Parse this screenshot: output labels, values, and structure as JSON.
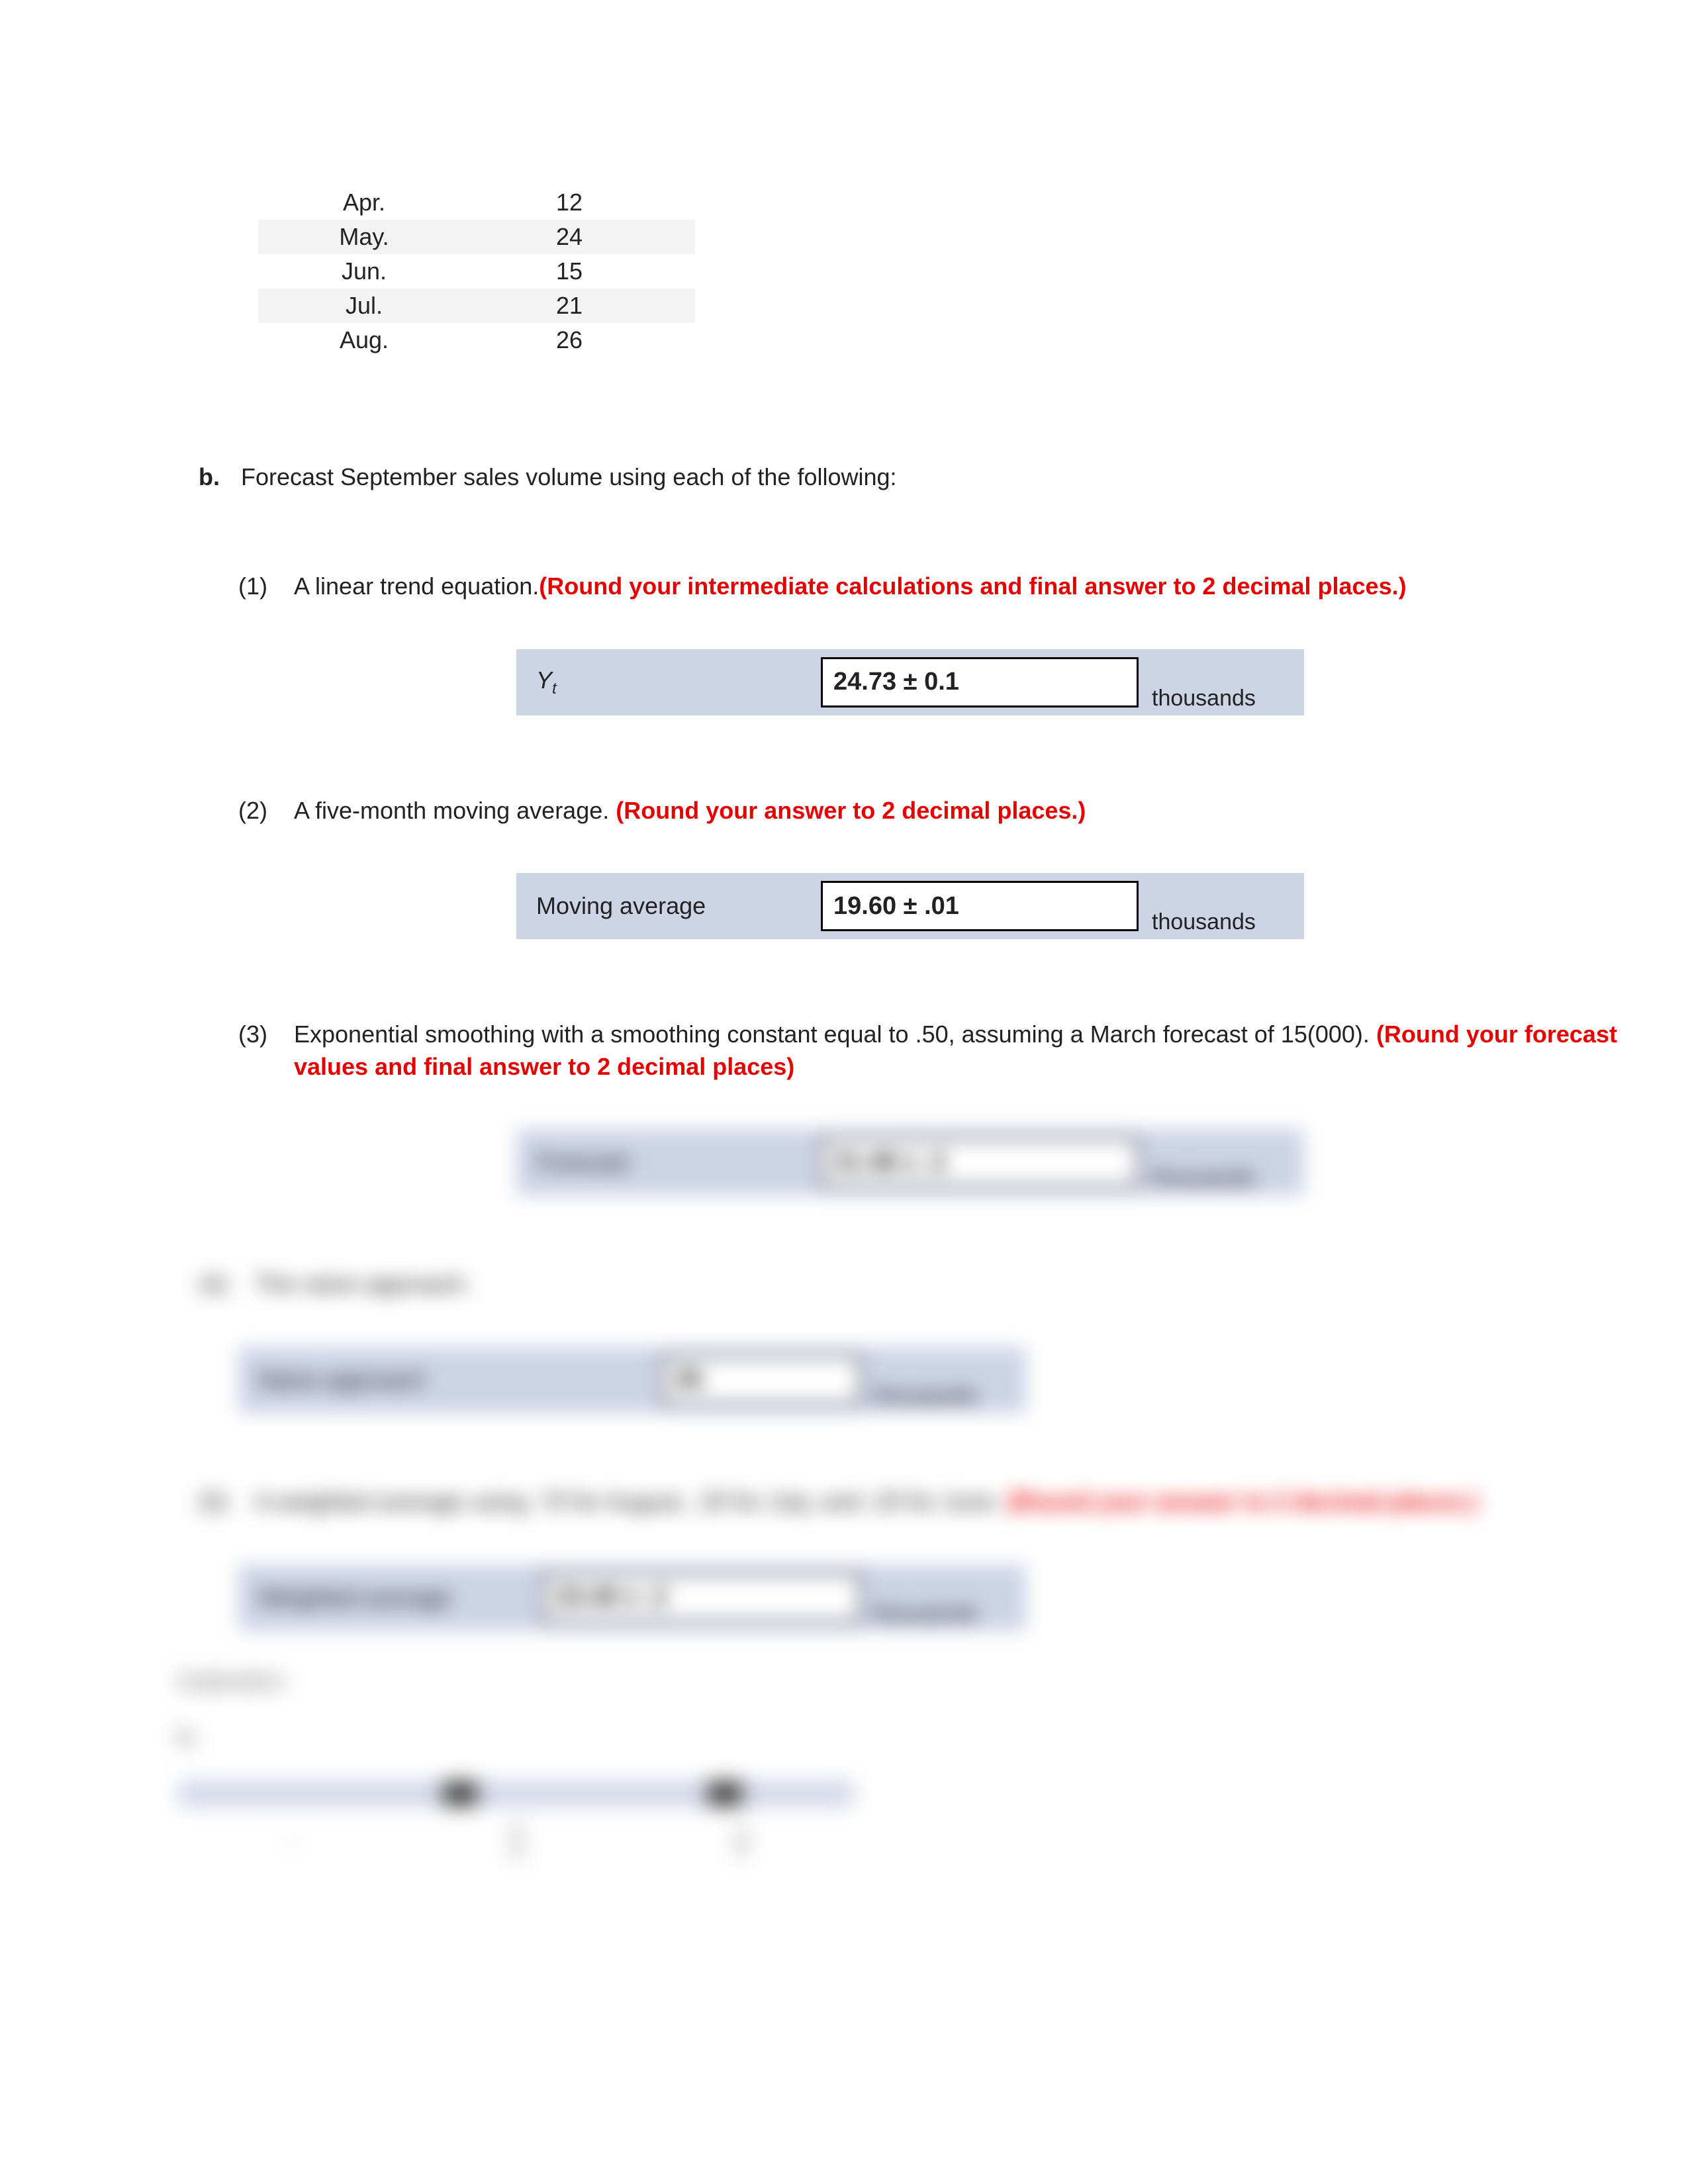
{
  "table": {
    "rows": [
      {
        "month": "Apr.",
        "value": "12",
        "striped": false
      },
      {
        "month": "May.",
        "value": "24",
        "striped": true
      },
      {
        "month": "Jun.",
        "value": "15",
        "striped": false
      },
      {
        "month": "Jul.",
        "value": "21",
        "striped": true
      },
      {
        "month": "Aug.",
        "value": "26",
        "striped": false
      }
    ]
  },
  "question_b": {
    "marker": "b.",
    "text": "Forecast September sales volume using each of the following:"
  },
  "parts": {
    "p1": {
      "marker": "(1)",
      "text": "A linear trend equation.",
      "red_text": "(Round your intermediate calculations and final answer to 2 decimal places.)",
      "answer_label_prefix": "Y",
      "answer_label_sub": "t",
      "answer_value": "24.73 ± 0.1",
      "answer_unit": "thousands"
    },
    "p2": {
      "marker": "(2)",
      "text": "A five-month moving average. ",
      "red_text": "(Round your answer to 2 decimal places.)",
      "answer_label": "Moving average",
      "answer_value": "19.60 ± .01",
      "answer_unit": "thousands"
    },
    "p3": {
      "marker": "(3)",
      "text_a": "Exponential smoothing with a smoothing constant equal to .50, assuming a March forecast of 15(000). ",
      "red_text": "(Round your forecast values and final answer to 2 decimal places)",
      "answer_label": "Forecast",
      "answer_value": "21.48 ± .3",
      "answer_unit": "thousands"
    },
    "p4": {
      "marker": "(4)",
      "text": "The naive approach.",
      "answer_label": "Naive approach",
      "answer_value": "26",
      "answer_unit": "thousands"
    },
    "p5": {
      "marker": "(5)",
      "text": "A weighted average using .70 for August, .20 for July, and .20 for June. ",
      "red_text": "(Round your answer to 2 decimal places.)",
      "answer_label": "Weighted average",
      "answer_value": "23.40 ± .2",
      "answer_unit": "thousands"
    }
  },
  "explanation": {
    "title": "Explanation:",
    "sub": "b."
  }
}
